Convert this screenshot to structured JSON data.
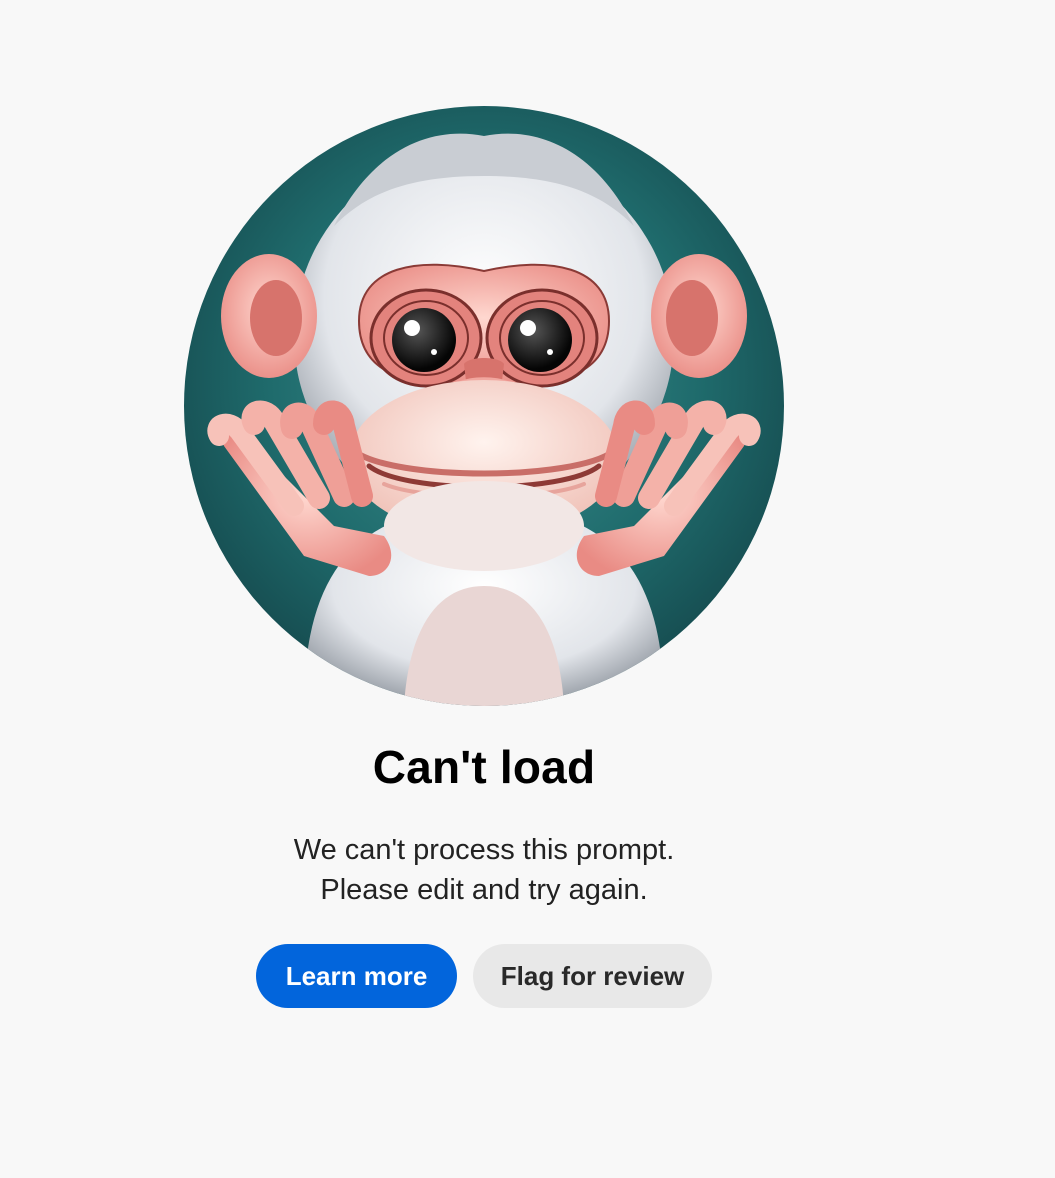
{
  "illustration": {
    "icon": "monkey-shrugging-illustration",
    "background_color": "#1f6b6c",
    "fur_color": "#e9ebef",
    "skin_color": "#e98b84"
  },
  "error": {
    "title": "Can't load",
    "message_line1": "We can't process this prompt.",
    "message_line2": "Please edit and try again."
  },
  "actions": {
    "learn_more_label": "Learn more",
    "flag_label": "Flag for review",
    "primary_color": "#0265dc"
  }
}
